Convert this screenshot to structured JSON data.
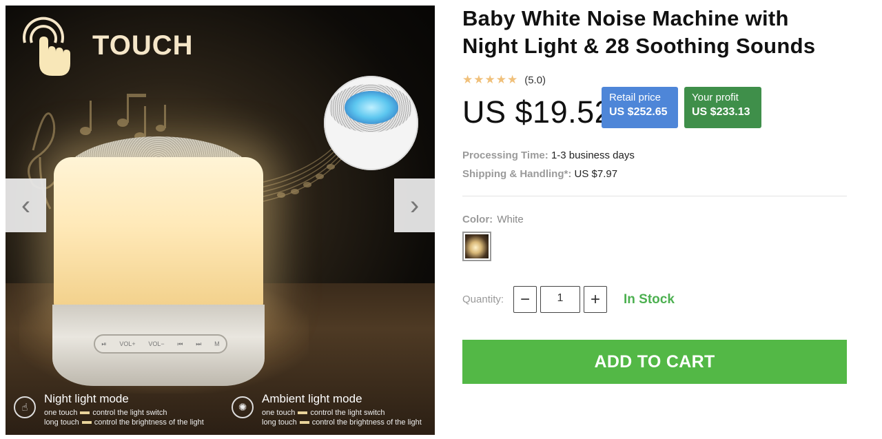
{
  "gallery": {
    "image_alt": "White noise machine with night light",
    "overlay_text": "TOUCH",
    "lamp_buttons": [
      "⏯",
      "VOL+",
      "VOL−",
      "⏮",
      "⏭",
      "M"
    ],
    "modes": [
      {
        "icon": "hand-touch-icon",
        "title": "Night light mode",
        "line1_a": "one touch",
        "line1_b": "control the light switch",
        "line2_a": "long touch",
        "line2_b": "control the brightness of the light"
      },
      {
        "icon": "brightness-icon",
        "title": "Ambient light mode",
        "line1_a": "one touch",
        "line1_b": "control the light switch",
        "line2_a": "long touch",
        "line2_b": "control the brightness of the light"
      }
    ],
    "prev_icon": "‹",
    "next_icon": "›"
  },
  "product": {
    "title": "Baby White Noise Machine with Night Light & 28 Soothing Sounds",
    "stars": "★★★★★",
    "rating_text": "(5.0)",
    "rating": 5.0,
    "price": "US $19.52",
    "retail": {
      "label": "Retail price",
      "value": "US $252.65",
      "color": "#4e86d8"
    },
    "profit": {
      "label": "Your profit",
      "value": "US $233.13",
      "color": "#3f8f4a"
    },
    "processing": {
      "label": "Processing Time:",
      "value": "1-3 business days"
    },
    "shipping": {
      "label": "Shipping & Handling*:",
      "value": "US $7.97"
    },
    "color": {
      "label": "Color:",
      "value": "White"
    },
    "quantity": {
      "label": "Quantity:",
      "value": "1",
      "minus": "−",
      "plus": "+"
    },
    "stock": "In Stock",
    "add_to_cart": "ADD TO CART",
    "accent_green": "#53b846"
  }
}
